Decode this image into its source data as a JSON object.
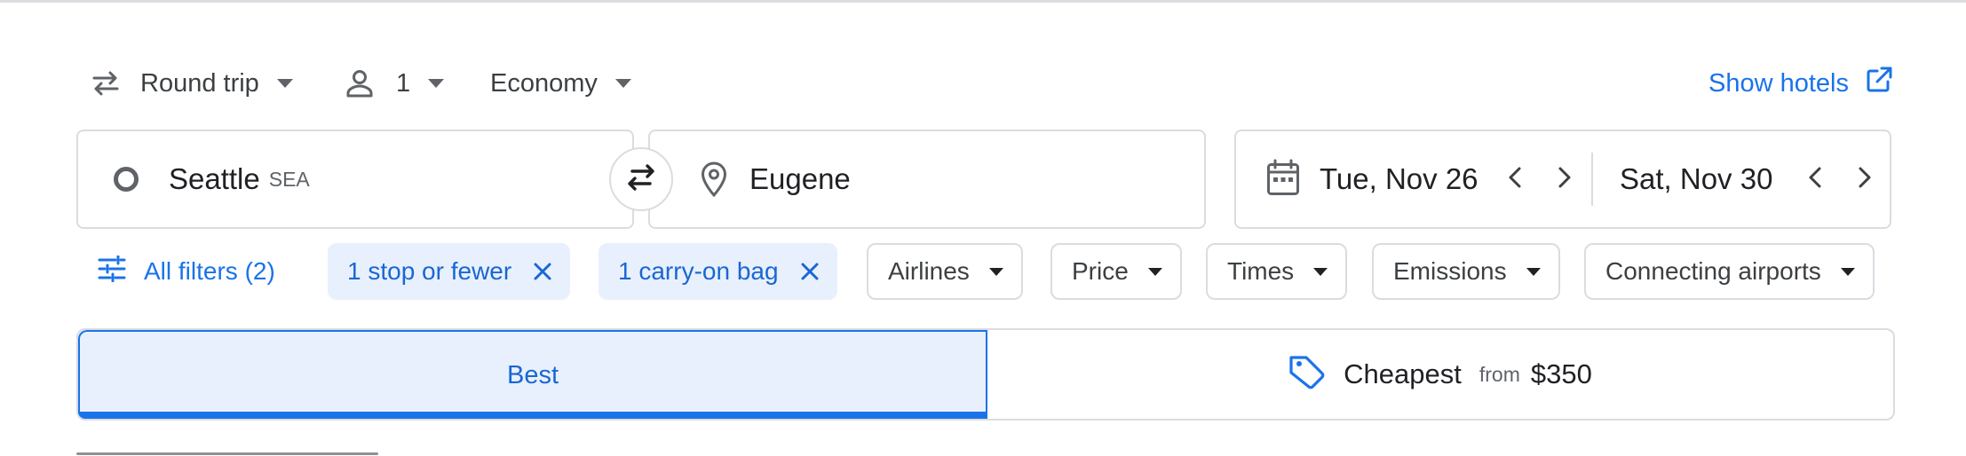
{
  "trip_options": {
    "trip_type": "Round trip",
    "passengers": "1",
    "cabin_class": "Economy"
  },
  "show_hotels": "Show hotels",
  "origin": {
    "city": "Seattle",
    "code": "SEA"
  },
  "destination": {
    "city": "Eugene"
  },
  "dates": {
    "departure": "Tue, Nov 26",
    "return": "Sat, Nov 30"
  },
  "filters": {
    "all_filters": "All filters (2)",
    "active": [
      {
        "label": "1 stop or fewer"
      },
      {
        "label": "1 carry-on bag"
      }
    ],
    "dropdowns": [
      {
        "label": "Airlines"
      },
      {
        "label": "Price"
      },
      {
        "label": "Times"
      },
      {
        "label": "Emissions"
      },
      {
        "label": "Connecting airports"
      }
    ]
  },
  "sort_tabs": {
    "best": "Best",
    "cheapest": "Cheapest",
    "cheapest_from": "from",
    "cheapest_price": "$350"
  },
  "colors": {
    "accent": "#1a73e8",
    "accent_bg": "#e8f0fe",
    "border": "#dadce0",
    "icon": "#5f6368",
    "text": "#202124"
  },
  "icons": {
    "trip_type": "swap-horizontal-icon",
    "passengers": "person-icon",
    "caret": "caret-down-icon",
    "external": "open-in-new-icon",
    "origin": "origin-circle-icon",
    "swap": "swap-arrows-icon",
    "destination": "location-pin-icon",
    "calendar": "calendar-icon",
    "prev": "chevron-left-icon",
    "next": "chevron-right-icon",
    "filters": "tune-icon",
    "remove": "close-icon",
    "price_tag": "tag-icon"
  }
}
